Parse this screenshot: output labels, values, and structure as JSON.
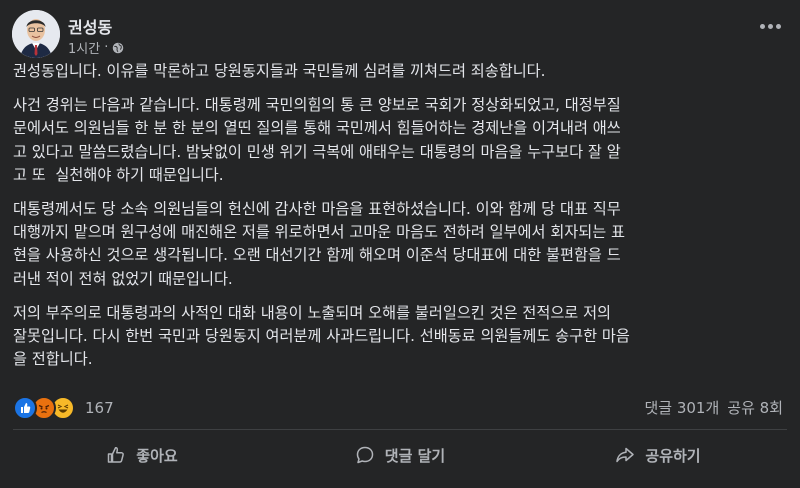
{
  "post": {
    "author": "권성동",
    "time": "1시간",
    "visibility_icon": "globe-icon",
    "paragraphs": [
      "권성동입니다. 이유를 막론하고 당원동지들과 국민들께 심려를 끼쳐드려 죄송합니다.",
      "사건 경위는 다음과 같습니다. 대통령께 국민의힘의 통 큰 양보로 국회가 정상화되었고, 대정부질\n문에서도 의원님들 한 분 한 분의 열띤 질의를 통해 국민께서 힘들어하는 경제난을 이겨내려 애쓰\n고 있다고 말씀드렸습니다. 밤낮없이 민생 위기 극복에 애태우는 대통령의 마음을 누구보다 잘 알\n고 또  실천해야 하기 때문입니다.",
      "대통령께서도 당 소속 의원님들의 헌신에 감사한 마음을 표현하셨습니다. 이와 함께 당 대표 직무\n대행까지 맡으며 원구성에 매진해온 저를 위로하면서 고마운 마음도 전하려 일부에서 회자되는 표\n현을 사용하신 것으로 생각됩니다. 오랜 대선기간 함께 해오며 이준석 당대표에 대한 불편함을 드\n러낸 적이 전혀 없었기 때문입니다.",
      "저의 부주의로 대통령과의 사적인 대화 내용이 노출되며 오해를 불러일으킨 것은 전적으로 저의\n잘못입니다. 다시 한번 국민과 당원동지 여러분께 사과드립니다. 선배동료 의원들께도 송구한 마음\n을 전합니다."
    ]
  },
  "stats": {
    "reaction_icons": [
      "like-icon",
      "angry-icon",
      "haha-icon"
    ],
    "reaction_count": "167",
    "comments": "댓글 301개",
    "shares": "공유 8회"
  },
  "actions": {
    "like": "좋아요",
    "comment": "댓글 달기",
    "share": "공유하기"
  },
  "colors": {
    "background": "#242526",
    "text": "#e4e6eb",
    "secondary_text": "#b0b3b8",
    "like_blue": "#1b74e4",
    "angry_orange": "#e9710f",
    "haha_yellow": "#f7b928"
  }
}
